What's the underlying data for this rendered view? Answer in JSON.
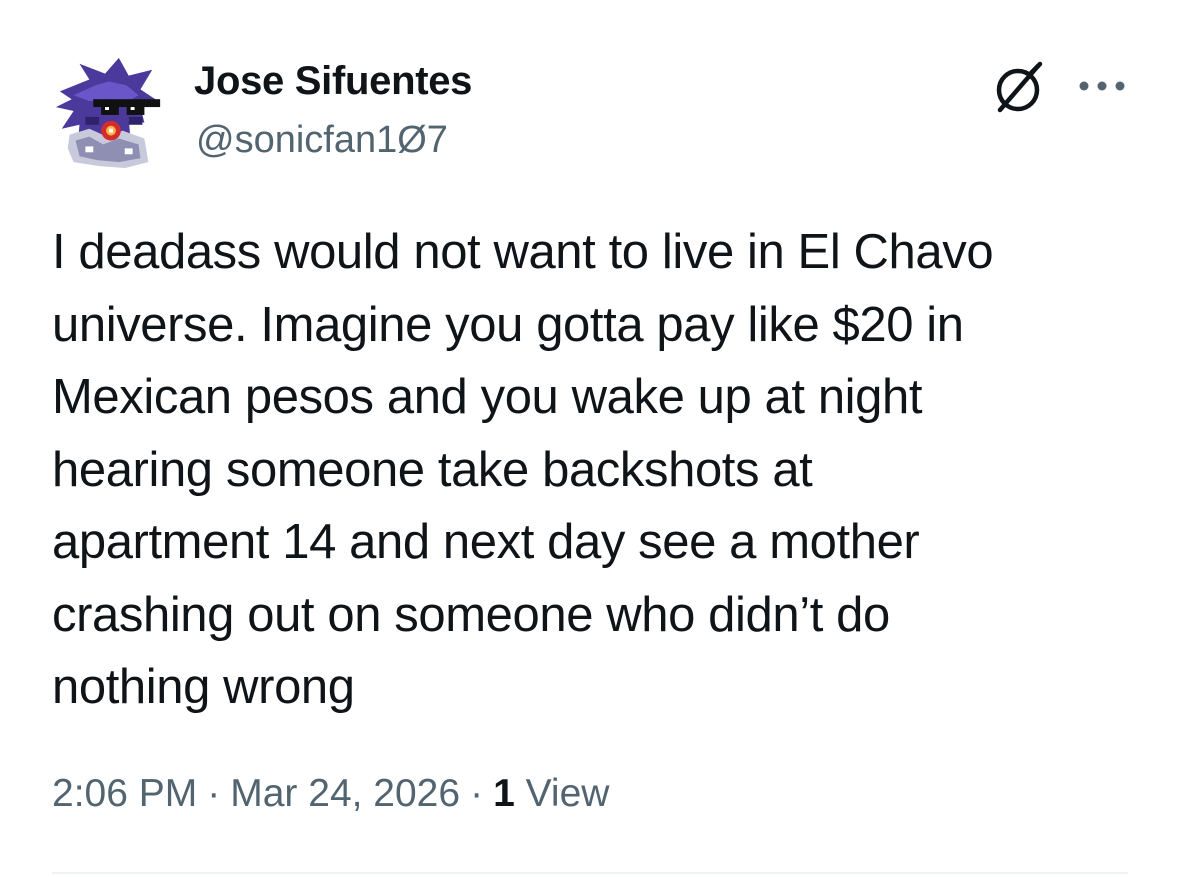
{
  "author": {
    "display_name": "Jose Sifuentes",
    "handle": "@sonicfan1Ø7",
    "avatar_icon": "pixel-art-avatar"
  },
  "header_actions": {
    "grok_icon": "grok-icon",
    "more_icon": "more-horizontal-icon"
  },
  "tweet": {
    "text": "I deadass would not want to live in El Chavo\nuniverse. Imagine you gotta pay like $20 in\nMexican pesos and you wake up at night\nhearing someone take backshots at\napartment 14 and next day see a mother\ncrashing out on someone who didn’t do\nnothing wrong"
  },
  "meta": {
    "time": "2:06 PM",
    "separator": "·",
    "date": "Mar 24, 2026",
    "views_count": "1",
    "views_label": "View"
  },
  "colors": {
    "text_primary": "#0f1419",
    "text_secondary": "#536471",
    "divider": "#eff3f4",
    "background": "#ffffff"
  }
}
